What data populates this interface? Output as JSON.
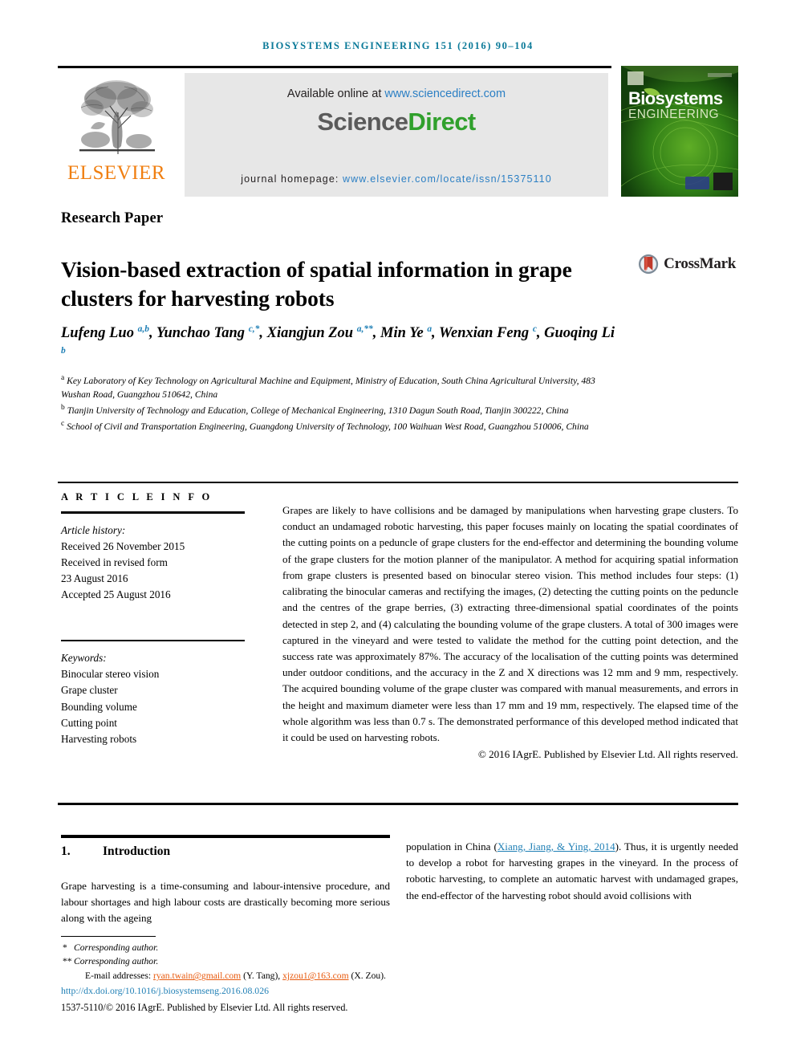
{
  "running_head": "BIOSYSTEMS ENGINEERING 151 (2016) 90–104",
  "masthead": {
    "publisher_name": "ELSEVIER",
    "available_prefix": "Available online at ",
    "available_url": "www.sciencedirect.com",
    "brand_first": "Science",
    "brand_second": "Direct",
    "homepage_label": "journal homepage: ",
    "homepage_url": "www.elsevier.com/locate/issn/15375110",
    "cover_title_line1": "Biosystems",
    "cover_title_line2": "ENGINEERING"
  },
  "article": {
    "section_label": "Research Paper",
    "title": "Vision-based extraction of spatial information in grape clusters for harvesting robots",
    "crossmark_label": "CrossMark",
    "authors_html": "Lufeng Luo <sup>a,b</sup>, Yunchao Tang <sup>c,*</sup>, Xiangjun Zou <sup>a,**</sup>, Min Ye <sup>a</sup>, Wenxian Feng <sup>c</sup>, Guoqing Li <sup>b</sup>",
    "affiliations": [
      "Key Laboratory of Key Technology on Agricultural Machine and Equipment, Ministry of Education, South China Agricultural University, 483 Wushan Road, Guangzhou 510642, China",
      "Tianjin University of Technology and Education, College of Mechanical Engineering, 1310 Dagun South Road, Tianjin 300222, China",
      "School of Civil and Transportation Engineering, Guangdong University of Technology, 100 Waihuan West Road, Guangzhou 510006, China"
    ],
    "affiliation_marks": [
      "a",
      "b",
      "c"
    ]
  },
  "info": {
    "heading": "A R T I C L E   I N F O",
    "history_label": "Article history:",
    "history": [
      "Received 26 November 2015",
      "Received in revised form",
      "23 August 2016",
      "Accepted 25 August 2016"
    ],
    "keywords_label": "Keywords:",
    "keywords": [
      "Binocular stereo vision",
      "Grape cluster",
      "Bounding volume",
      "Cutting point",
      "Harvesting robots"
    ]
  },
  "abstract": {
    "text": "Grapes are likely to have collisions and be damaged by manipulations when harvesting grape clusters. To conduct an undamaged robotic harvesting, this paper focuses mainly on locating the spatial coordinates of the cutting points on a peduncle of grape clusters for the end-effector and determining the bounding volume of the grape clusters for the motion planner of the manipulator. A method for acquiring spatial information from grape clusters is presented based on binocular stereo vision. This method includes four steps: (1) calibrating the binocular cameras and rectifying the images, (2) detecting the cutting points on the peduncle and the centres of the grape berries, (3) extracting three-dimensional spatial coordinates of the points detected in step 2, and (4) calculating the bounding volume of the grape clusters. A total of 300 images were captured in the vineyard and were tested to validate the method for the cutting point detection, and the success rate was approximately 87%. The accuracy of the localisation of the cutting points was determined under outdoor conditions, and the accuracy in the Z and X directions was 12 mm and 9 mm, respectively. The acquired bounding volume of the grape cluster was compared with manual measurements, and errors in the height and maximum diameter were less than 17 mm and 19 mm, respectively. The elapsed time of the whole algorithm was less than 0.7 s. The demonstrated performance of this developed method indicated that it could be used on harvesting robots.",
    "copyright": "© 2016 IAgrE. Published by Elsevier Ltd. All rights reserved."
  },
  "body": {
    "section_number": "1.",
    "section_title": "Introduction",
    "left_column": "Grape harvesting is a time-consuming and labour-intensive procedure, and labour shortages and high labour costs are drastically becoming more serious along with the ageing",
    "right_column_pre": "population in China (",
    "right_column_citation": "Xiang, Jiang, & Ying, 2014",
    "right_column_post": "). Thus, it is urgently needed to develop a robot for harvesting grapes in the vineyard. In the process of robotic harvesting, to complete an automatic harvest with undamaged grapes, the end-effector of the harvesting robot should avoid collisions with"
  },
  "footnotes": {
    "corresponding_1_mark": "*",
    "corresponding_1": "Corresponding author.",
    "corresponding_2_mark": "**",
    "corresponding_2": "Corresponding author.",
    "email_label": "E-mail addresses: ",
    "email_1": "ryan.twain@gmail.com",
    "email_1_owner": " (Y. Tang), ",
    "email_2": "xjzou1@163.com",
    "email_2_owner": " (X. Zou).",
    "doi": "http://dx.doi.org/10.1016/j.biosystemseng.2016.08.026",
    "issn_line": "1537-5110/© 2016 IAgrE. Published by Elsevier Ltd. All rights reserved."
  },
  "colors": {
    "running_head": "#0b7a99",
    "link_blue": "#2b7fc4",
    "citation_blue": "#1f7fb5",
    "email_orange": "#e8590c",
    "sciencedirect_green": "#30a02c",
    "elsevier_orange": "#f07f11"
  }
}
